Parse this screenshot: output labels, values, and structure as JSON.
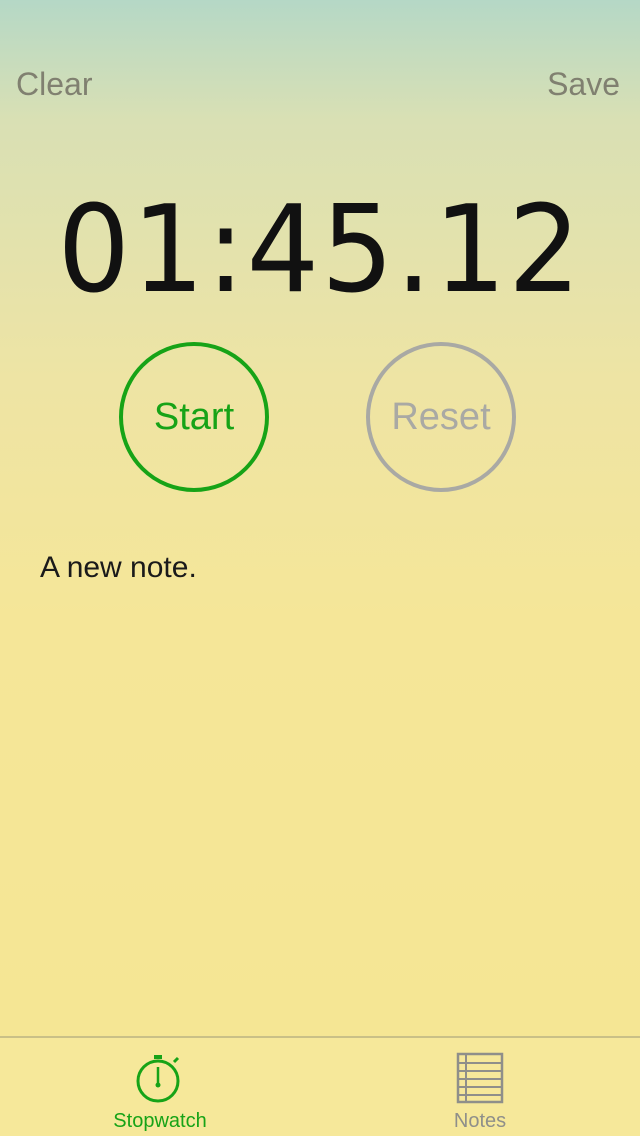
{
  "nav": {
    "clear_label": "Clear",
    "save_label": "Save"
  },
  "stopwatch": {
    "time": "01:45.12",
    "start_label": "Start",
    "reset_label": "Reset"
  },
  "note": {
    "text": "A new note."
  },
  "tabbar": {
    "tabs": [
      {
        "label": "Stopwatch",
        "icon": "stopwatch-icon",
        "selected": true
      },
      {
        "label": "Notes",
        "icon": "notes-icon",
        "selected": false
      }
    ]
  },
  "colors": {
    "accent_green": "#17a317",
    "inactive_gray": "#a9a9a4",
    "nav_text": "#808070",
    "background_top": "#b5d8c6",
    "background_bottom": "#f5e694"
  }
}
